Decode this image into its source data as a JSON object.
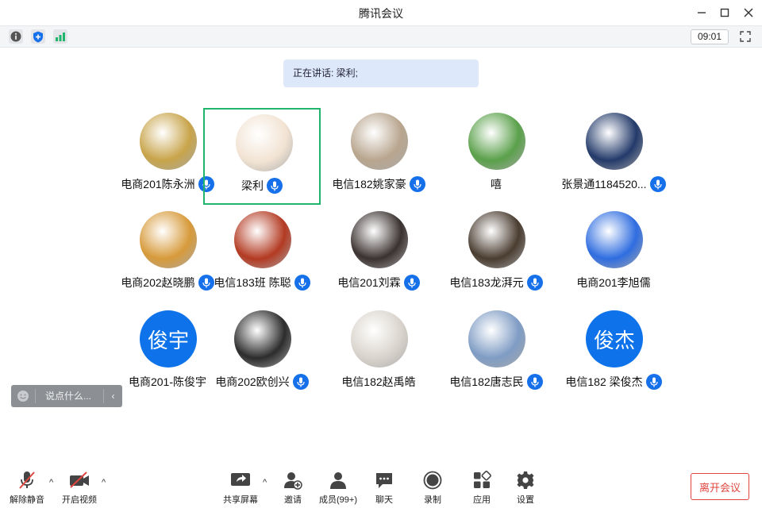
{
  "window": {
    "title": "腾讯会议"
  },
  "toolbar": {
    "timer": "09:01"
  },
  "speaking_banner": "正在讲话: 梁利;",
  "participants": [
    {
      "name": "电商201陈永洲",
      "avatar": "photo",
      "color": "#c8a44a",
      "mic": true
    },
    {
      "name": "梁利",
      "avatar": "photo",
      "color": "#f2e3d3",
      "mic": true,
      "active": true
    },
    {
      "name": "电信182姚家豪",
      "avatar": "photo",
      "color": "#b8a58e",
      "mic": true
    },
    {
      "name": "嘻",
      "avatar": "photo",
      "color": "#5aa04a",
      "mic": false
    },
    {
      "name": "张景通1184520...",
      "avatar": "photo",
      "color": "#233a6a",
      "mic": true
    },
    {
      "name": "电商202赵晓鹏",
      "avatar": "photo",
      "color": "#d79a3a",
      "mic": true
    },
    {
      "name": "电信183班 陈聪",
      "avatar": "photo",
      "color": "#b33a22",
      "mic": true
    },
    {
      "name": "电信201刘霖",
      "avatar": "photo",
      "color": "#3a3230",
      "mic": true
    },
    {
      "name": "电信183龙湃元",
      "avatar": "photo",
      "color": "#4a3c30",
      "mic": true
    },
    {
      "name": "电商201李旭儒",
      "avatar": "photo",
      "color": "#2f6de0",
      "mic": false
    },
    {
      "name": "电商201-陈俊宇",
      "avatar": "text",
      "avatar_text": "俊宇",
      "color": "#0e72ea",
      "mic": false
    },
    {
      "name": "电商202欧创兴",
      "avatar": "photo",
      "color": "#2c2c2c",
      "mic": true
    },
    {
      "name": "电信182赵禹皓",
      "avatar": "photo",
      "color": "#d9d4cc",
      "mic": false
    },
    {
      "name": "电信182唐志民",
      "avatar": "photo",
      "color": "#7f9cc4",
      "mic": true
    },
    {
      "name": "电信182 梁俊杰",
      "avatar": "text",
      "avatar_text": "俊杰",
      "color": "#0e72ea",
      "mic": true
    }
  ],
  "chat": {
    "placeholder": "说点什么..."
  },
  "bottom_bar": {
    "unmute": "解除静音",
    "start_video": "开启视频",
    "share": "共享屏幕",
    "invite": "邀请",
    "members": "成员(99+)",
    "chat": "聊天",
    "record": "录制",
    "apps": "应用",
    "settings": "设置",
    "leave": "离开会议"
  },
  "colors": {
    "accent": "#1670ea",
    "active_border": "#1fb56c",
    "leave": "#e0463f"
  }
}
